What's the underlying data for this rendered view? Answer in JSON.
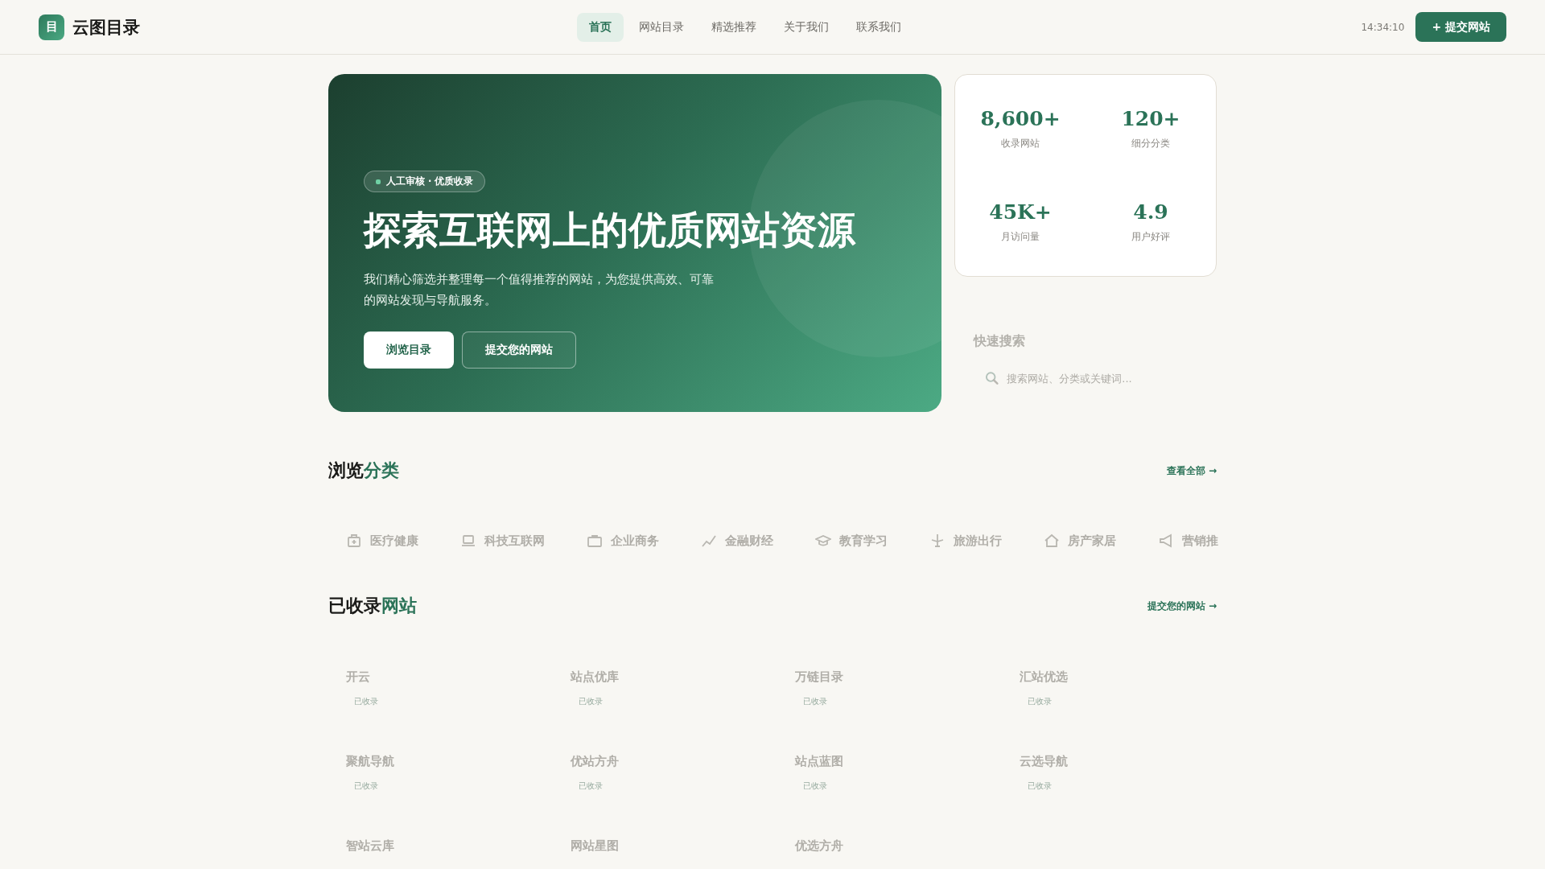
{
  "header": {
    "logo_mark": "目",
    "brand": "云图目录",
    "nav": [
      {
        "label": "首页",
        "selected": true
      },
      {
        "label": "网站目录",
        "selected": false
      },
      {
        "label": "精选推荐",
        "selected": false
      },
      {
        "label": "关于我们",
        "selected": false
      },
      {
        "label": "联系我们",
        "selected": false
      }
    ],
    "time": "14:34:10",
    "submit_button": "+ 提交网站"
  },
  "hero": {
    "badge": "人工审核 · 优质收录",
    "title": "探索互联网上的优质网站资源",
    "description": "我们精心筛选并整理每一个值得推荐的网站，为您提供高效、可靠的网站发现与导航服务。",
    "buttons": [
      {
        "label": "浏览目录",
        "kind": "primary"
      },
      {
        "label": "提交您的网站",
        "kind": "outline"
      }
    ]
  },
  "stats": [
    {
      "value": "8,600+",
      "label": "收录网站"
    },
    {
      "value": "120+",
      "label": "细分分类"
    },
    {
      "value": "45K+",
      "label": "月访问量"
    },
    {
      "value": "4.9",
      "label": "用户好评"
    }
  ],
  "quick_search": {
    "title": "快速搜索",
    "placeholder": "搜索网站、分类或关键词..."
  },
  "categories": {
    "title": "浏览",
    "title_highlight": "分类",
    "link": "查看全部 →",
    "items": [
      {
        "label": "医疗健康"
      },
      {
        "label": "科技互联网"
      },
      {
        "label": "企业商务"
      },
      {
        "label": "金融财经"
      },
      {
        "label": "教育学习"
      },
      {
        "label": "旅游出行"
      },
      {
        "label": "房产家居"
      },
      {
        "label": "营销推"
      }
    ]
  },
  "sites": {
    "title": "已收录",
    "title_highlight": "网站",
    "link": "提交您的网站 →",
    "items": [
      {
        "name": "开云",
        "badge": "已收录"
      },
      {
        "name": "站点优库",
        "badge": "已收录"
      },
      {
        "name": "万链目录",
        "badge": "已收录"
      },
      {
        "name": "汇站优选",
        "badge": "已收录"
      },
      {
        "name": "聚航导航",
        "badge": "已收录"
      },
      {
        "name": "优站方舟",
        "badge": "已收录"
      },
      {
        "name": "站点蓝图",
        "badge": "已收录"
      },
      {
        "name": "云选导航",
        "badge": "已收录"
      },
      {
        "name": "智站云库"
      },
      {
        "name": "网站星图"
      },
      {
        "name": "优选方舟"
      }
    ]
  }
}
